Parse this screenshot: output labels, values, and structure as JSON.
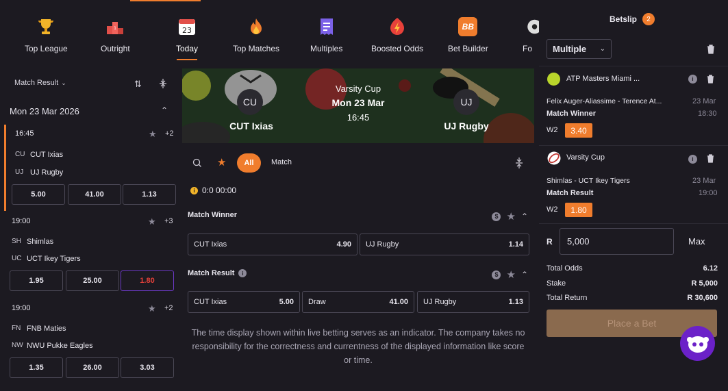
{
  "nav": {
    "items": [
      {
        "label": "Top League",
        "icon": "trophy-icon"
      },
      {
        "label": "Outright",
        "icon": "podium-icon"
      },
      {
        "label": "Today",
        "icon": "calendar-icon",
        "date": "23"
      },
      {
        "label": "Top Matches",
        "icon": "fire-icon"
      },
      {
        "label": "Multiples",
        "icon": "ticket-icon"
      },
      {
        "label": "Boosted Odds",
        "icon": "lightning-icon"
      },
      {
        "label": "Bet Builder",
        "icon": "bet-builder-icon",
        "badge": "BB"
      },
      {
        "label": "Fo",
        "icon": "football-icon"
      }
    ],
    "active": "Today"
  },
  "left": {
    "filter": "Match Result",
    "date": "Mon 23 Mar 2026",
    "matches": [
      {
        "time": "16:45",
        "plus": "+2",
        "teams": [
          {
            "abbr": "CU",
            "name": "CUT Ixias"
          },
          {
            "abbr": "UJ",
            "name": "UJ Rugby"
          }
        ],
        "odds": [
          "5.00",
          "41.00",
          "1.13"
        ]
      },
      {
        "time": "19:00",
        "plus": "+3",
        "teams": [
          {
            "abbr": "SH",
            "name": "Shimlas"
          },
          {
            "abbr": "UC",
            "name": "UCT Ikey Tigers"
          }
        ],
        "odds": [
          "1.95",
          "25.00",
          "1.80"
        ]
      },
      {
        "time": "19:00",
        "plus": "+2",
        "teams": [
          {
            "abbr": "FN",
            "name": "FNB Maties"
          },
          {
            "abbr": "NW",
            "name": "NWU Pukke Eagles"
          }
        ],
        "odds": [
          "1.35",
          "26.00",
          "3.03"
        ]
      }
    ]
  },
  "banner": {
    "competition": "Varsity Cup",
    "date": "Mon 23 Mar",
    "time": "16:45",
    "home_abbr": "CU",
    "home": "CUT Ixias",
    "away_abbr": "UJ",
    "away": "UJ Rugby"
  },
  "controls": {
    "all": "All",
    "match": "Match"
  },
  "score": "0:0 00:00",
  "markets": [
    {
      "title": "Match Winner",
      "selections": [
        {
          "label": "CUT Ixias",
          "odd": "4.90"
        },
        {
          "label": "UJ Rugby",
          "odd": "1.14"
        }
      ]
    },
    {
      "title": "Match Result",
      "selections": [
        {
          "label": "CUT Ixias",
          "odd": "5.00"
        },
        {
          "label": "Draw",
          "odd": "41.00"
        },
        {
          "label": "UJ Rugby",
          "odd": "1.13"
        }
      ]
    }
  ],
  "disclaimer": "The time display shown within live betting serves as an indicator. The company takes no responsibility for the correctness and currentness of the displayed information like score or time.",
  "betslip": {
    "title": "Betslip",
    "count": "2",
    "type": "Multiple",
    "bets": [
      {
        "competition": "ATP Masters Miami ...",
        "match": "Felix Auger-Aliassime - Terence At...",
        "date": "23 Mar",
        "time": "18:30",
        "market": "Match Winner",
        "pick": "W2",
        "odd": "3.40"
      },
      {
        "competition": "Varsity Cup",
        "match": "Shimlas - UCT Ikey Tigers",
        "date": "23 Mar",
        "time": "19:00",
        "market": "Match Result",
        "pick": "W2",
        "odd": "1.80"
      }
    ],
    "currency": "R",
    "stake_value": "5,000",
    "max": "Max",
    "totals": [
      {
        "label": "Total Odds",
        "value": "6.12"
      },
      {
        "label": "Stake",
        "value": "R 5,000"
      },
      {
        "label": "Total Return",
        "value": "R 30,600"
      }
    ],
    "place_bet": "Place a Bet"
  },
  "colors": {
    "accent": "#f07d2d",
    "background": "#1c1a21",
    "purple": "#6b21c8"
  }
}
